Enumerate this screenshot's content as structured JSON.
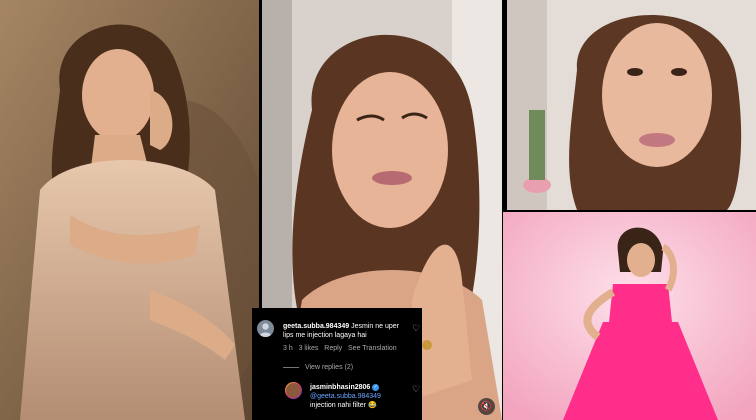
{
  "comments": {
    "comment1": {
      "username": "geeta.subba.984349",
      "text": "Jesmin ne uper lips me injection lagaya hai",
      "time": "3 h",
      "likes": "3 likes",
      "reply_label": "Reply",
      "translate_label": "See Translation"
    },
    "view_replies": "View replies (2)",
    "reply1": {
      "username": "jasminbhasin2806",
      "mention": "@geeta.subba.984349",
      "text": "injection nahi filter 😂"
    }
  },
  "icons": {
    "like": "heart-outline-icon",
    "verified": "verified-badge-icon",
    "mute": "speaker-muted-icon"
  },
  "colors": {
    "mention": "#6aa6ff",
    "verified": "#3897f0",
    "dress_pink": "#ff2e8a"
  }
}
